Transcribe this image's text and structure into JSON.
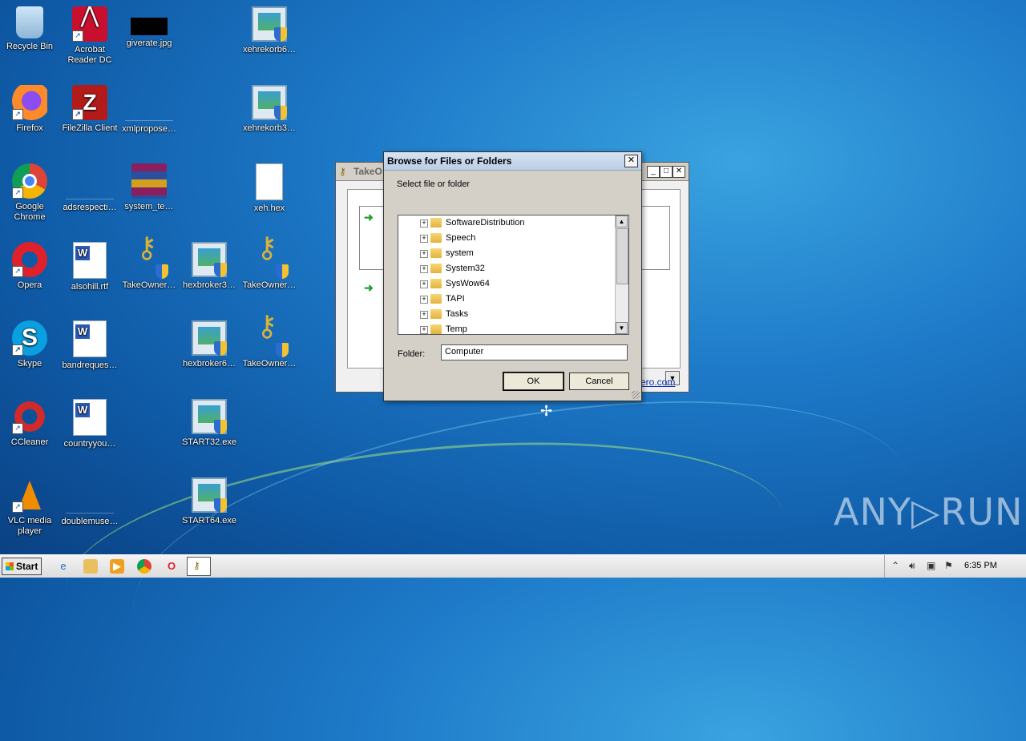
{
  "desktop": {
    "icons": [
      {
        "label": "Recycle Bin",
        "icon": "recycle-bin-icon"
      },
      {
        "label": "Acrobat Reader DC",
        "icon": "acrobat-icon"
      },
      {
        "label": "giverate.jpg",
        "icon": "image-file-icon"
      },
      {
        "label": "xehrekorb6…",
        "icon": "exe-icon"
      },
      {
        "label": "Firefox",
        "icon": "firefox-icon"
      },
      {
        "label": "FileZilla Client",
        "icon": "filezilla-icon"
      },
      {
        "label": "xmlpropose…",
        "icon": "blank-file-icon"
      },
      {
        "label": "xehrekorb3…",
        "icon": "exe-icon"
      },
      {
        "label": "Google Chrome",
        "icon": "chrome-icon"
      },
      {
        "label": "adsrespecti…",
        "icon": "blank-file-icon"
      },
      {
        "label": "system_te…",
        "icon": "winrar-icon"
      },
      {
        "label": "xeh.hex",
        "icon": "file-icon"
      },
      {
        "label": "Opera",
        "icon": "opera-icon"
      },
      {
        "label": "alsohill.rtf",
        "icon": "word-doc-icon"
      },
      {
        "label": "TakeOwner…",
        "icon": "keys-icon"
      },
      {
        "label": "hexbroker3…",
        "icon": "exe-icon"
      },
      {
        "label": "TakeOwner…",
        "icon": "keys-icon"
      },
      {
        "label": "Skype",
        "icon": "skype-icon"
      },
      {
        "label": "bandreques…",
        "icon": "word-doc-icon"
      },
      {
        "label": "hexbroker6…",
        "icon": "exe-icon"
      },
      {
        "label": "TakeOwner…",
        "icon": "keys-icon"
      },
      {
        "label": "CCleaner",
        "icon": "ccleaner-icon"
      },
      {
        "label": "countryyou…",
        "icon": "word-doc-icon"
      },
      {
        "label": "START32.exe",
        "icon": "exe-icon"
      },
      {
        "label": "VLC media player",
        "icon": "vlc-icon"
      },
      {
        "label": "doublemuse…",
        "icon": "blank-file-icon"
      },
      {
        "label": "START64.exe",
        "icon": "exe-icon"
      }
    ]
  },
  "bg_window": {
    "title": "TakeO",
    "link_text": "ero.com"
  },
  "dialog": {
    "title": "Browse for Files or Folders",
    "close_label": "✕",
    "prompt": "Select file or folder",
    "tree_items": [
      {
        "name": "SoftwareDistribution"
      },
      {
        "name": "Speech"
      },
      {
        "name": "system"
      },
      {
        "name": "System32"
      },
      {
        "name": "SysWow64"
      },
      {
        "name": "TAPI"
      },
      {
        "name": "Tasks"
      },
      {
        "name": "Temp"
      }
    ],
    "folder_label": "Folder:",
    "folder_value": "Computer",
    "ok_label": "OK",
    "cancel_label": "Cancel"
  },
  "watermark": "ANY▷RUN",
  "taskbar": {
    "start_label": "Start",
    "clock": "6:35 PM"
  },
  "colors": {
    "desktop_blue": "#1e7bc9",
    "dialog_face": "#d4d0c8"
  }
}
